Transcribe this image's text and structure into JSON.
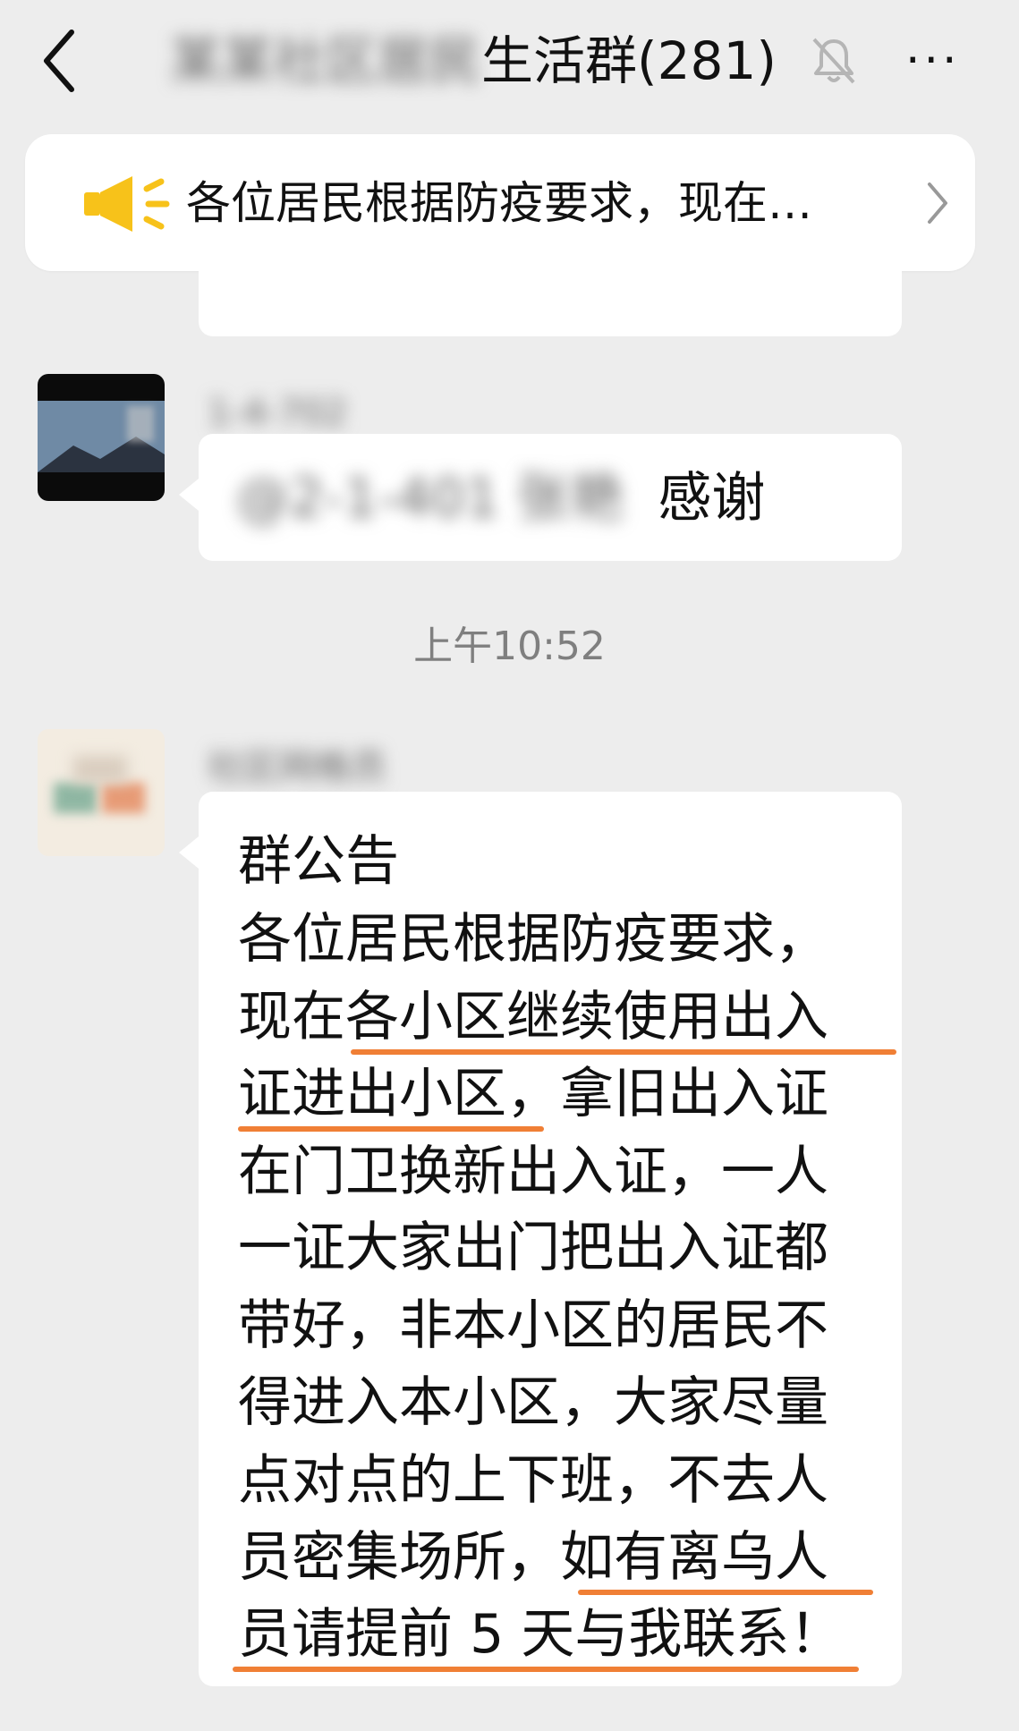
{
  "header": {
    "title_blurred": "某某社区居民",
    "title": "生活群(281)",
    "more_label": "···",
    "icons": {
      "back": "back-arrow-icon",
      "mute": "bell-muted-icon",
      "more": "more-icon"
    }
  },
  "pinned_notice": {
    "text": "各位居民根据防疫要求，现在…",
    "icons": {
      "speaker": "megaphone-icon",
      "chevron": "chevron-right-icon"
    },
    "accent_color": "#f7c21a"
  },
  "messages": [
    {
      "nickname_blurred": "1-4-702",
      "text_blurred": "@2-1-401 张艳",
      "text": "感谢"
    },
    {
      "timestamp": "上午10:52"
    },
    {
      "nickname_blurred": "社区网格员",
      "announcement_title": "群公告",
      "lines": [
        "各位居民根据防疫要求，",
        "现在各小区继续使用出入",
        "证进出小区，拿旧出入证",
        "在门卫换新出入证，一人",
        "一证大家出门把出入证都",
        "带好，非本小区的居民不",
        "得进入本小区，大家尽量",
        "点对点的上下班，不去人",
        "员密集场所，如有离乌人",
        "员请提前 5 天与我联系！"
      ],
      "underline_color": "#f07f35"
    }
  ]
}
